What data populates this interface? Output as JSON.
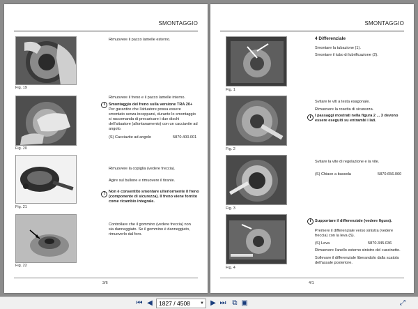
{
  "left_page": {
    "header": "SMONTAGGIO",
    "page_number": "3/6",
    "fig19": {
      "caption": "Fig. 19",
      "text": "Rimuovere il pacco lamelle esterno."
    },
    "fig20": {
      "caption": "Fig. 20",
      "text1": "Rimuovere il freno e il pacco lamelle interno.",
      "bold": "Smontaggio del freno sulla versione TRA 20+",
      "text2a": "Per garantire che l'attuatore possa essere",
      "text2b": "smontato senza incepparsi, durante lo smontaggio",
      "text2c": "si raccomanda di precaricare i due dischi",
      "text2d": "dell'attuatore (allontanamento) con un cacciavite ad",
      "text2e": "angolo.",
      "tool_label": "(S) Cacciavite ad angolo",
      "tool_code": "5870.400.001"
    },
    "fig21": {
      "caption": "Fig. 21",
      "text1": "Rimuovere la copiglia (vedere freccia).",
      "text2": "Agire sul bullone e rimuovere il tirante.",
      "warn1": "Non è consentito smontare ulteriormente il freno",
      "warn2": "(componente di sicurezza). Il freno viene fornito",
      "warn3": "come ricambio integrale."
    },
    "fig22": {
      "caption": "Fig. 22",
      "text1": "Controllare che il gommino (vedere freccia) non",
      "text2": "sia danneggiato.  Se il gommino è danneggiato,",
      "text3": "rimuoverlo dal foro."
    }
  },
  "right_page": {
    "header": "SMONTAGGIO",
    "page_number": "4/1",
    "fig1": {
      "caption": "Fig. 1",
      "section": "4 Differenziale",
      "text1": "Smontare la tubazione (1).",
      "text2": "Smontare il tubo di lubrificazione (2)."
    },
    "fig2": {
      "caption": "Fig. 2",
      "text1": "Svitare le viti a testa esagonale.",
      "text2": "Rimuovere la rosetta di sicurezza.",
      "bold1": "I passaggi mostrati nella figura 2 ... 3 devono",
      "bold2": "essere eseguiti su entrambi i lati."
    },
    "fig3": {
      "caption": "Fig. 3",
      "text1": "Svitare la vite di regolazione e la vite.",
      "tool_label": "(S) Chiave a bussola",
      "tool_code": "5870.656.060"
    },
    "fig4": {
      "caption": "Fig. 4",
      "bold": "Supportare il differenziale (vedere figura).",
      "text1": "Premere il differenziale verso sinistra (vedere",
      "text2": "freccia) con la leva (S).",
      "tool_label": "(S) Leva",
      "tool_code": "5870.345.036",
      "text3": "Rimuovere l'anello esterno sinistro del cuscinetto.",
      "text4": "Sollevare il differenziale liberandolo dalla scatola",
      "text5": "dell'assale posteriore."
    }
  },
  "toolbar": {
    "page_indicator": "1827 / 4508"
  }
}
